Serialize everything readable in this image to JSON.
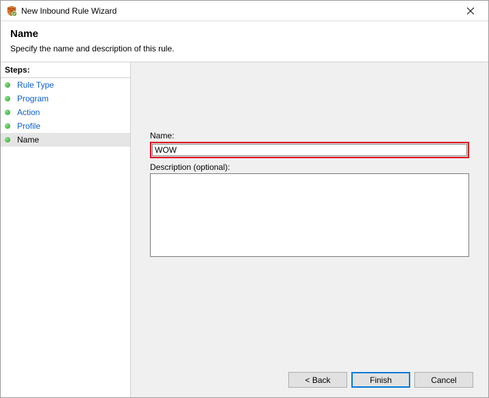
{
  "window": {
    "title": "New Inbound Rule Wizard"
  },
  "header": {
    "title": "Name",
    "subtitle": "Specify the name and description of this rule."
  },
  "sidebar": {
    "label": "Steps:",
    "items": [
      {
        "label": "Rule Type"
      },
      {
        "label": "Program"
      },
      {
        "label": "Action"
      },
      {
        "label": "Profile"
      },
      {
        "label": "Name"
      }
    ],
    "current_index": 4
  },
  "form": {
    "name_label": "Name:",
    "name_value": "WOW",
    "desc_label": "Description (optional):",
    "desc_value": ""
  },
  "buttons": {
    "back": "< Back",
    "finish": "Finish",
    "cancel": "Cancel"
  }
}
